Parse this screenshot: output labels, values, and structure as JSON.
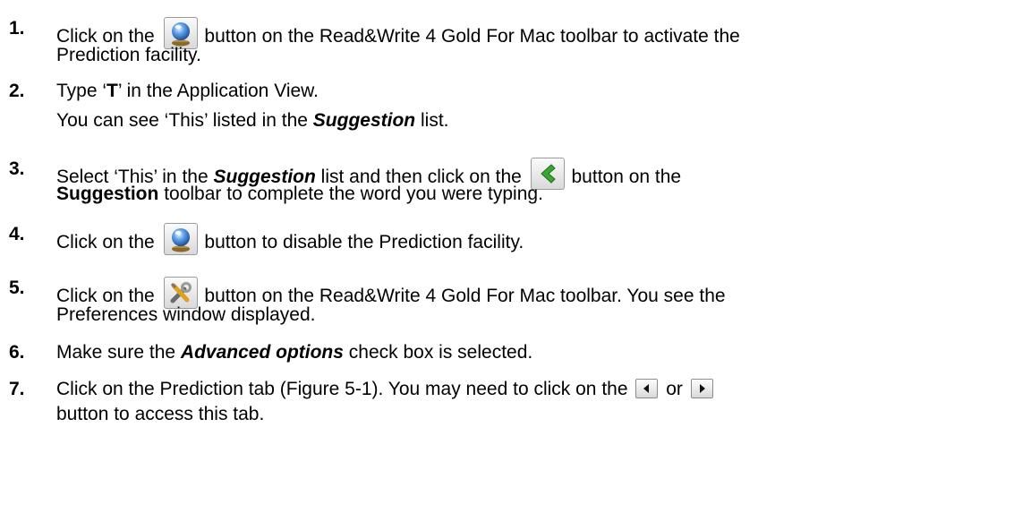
{
  "steps": [
    {
      "number": "1.",
      "a": "Click on the",
      "b": "button on the Read&Write 4 Gold For Mac toolbar to activate the",
      "c": "Prediction facility."
    },
    {
      "number": "2.",
      "a": "Type ‘",
      "b": "T",
      "c": "’ in the Application View.",
      "d": "You can see ‘This’ listed in the",
      "e": "Suggestion",
      "f": "list."
    },
    {
      "number": "3.",
      "a": "Select ‘This’ in the",
      "b": "Suggestion",
      "c": "list and then click on the",
      "d": "button on the",
      "e": "Suggestion",
      "f": "toolbar to complete the word you were typing."
    },
    {
      "number": "4.",
      "a": "Click on the",
      "b": "button to disable the Prediction facility."
    },
    {
      "number": "5.",
      "a": "Click on the",
      "b": "button on the Read&Write 4 Gold For Mac toolbar. You see the",
      "c": "Preferences window displayed."
    },
    {
      "number": "6.",
      "a": "Make sure the",
      "b": "Advanced options",
      "c": "check box is selected."
    },
    {
      "number": "7.",
      "a": "Click on the Prediction tab (Figure 5-1). You may need to click on the",
      "b": "or",
      "c": "button to access this tab."
    }
  ],
  "icons": {
    "prediction": "crystal-ball-icon",
    "complete_word": "green-chevron-left-icon",
    "preferences": "tools-icon",
    "scroll_left": "left-arrow-icon",
    "scroll_right": "right-arrow-icon"
  }
}
